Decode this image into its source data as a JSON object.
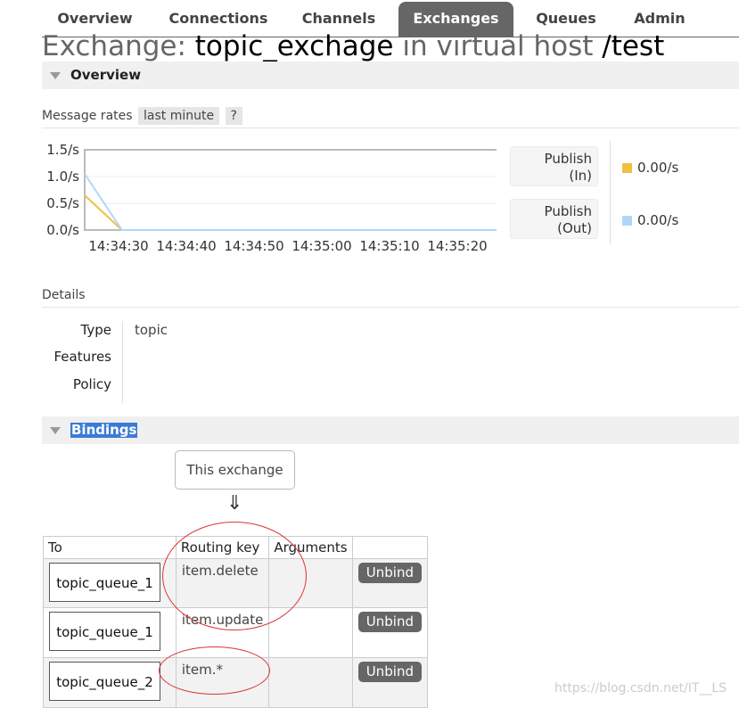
{
  "nav": {
    "tabs": [
      {
        "label": "Overview"
      },
      {
        "label": "Connections"
      },
      {
        "label": "Channels"
      },
      {
        "label": "Exchanges",
        "active": true
      },
      {
        "label": "Queues"
      },
      {
        "label": "Admin"
      }
    ]
  },
  "page": {
    "title_prefix": "Exchange:",
    "exchange_name": "topic_exchage",
    "title_mid": "in virtual host",
    "vhost": "/test"
  },
  "overview": {
    "header": "Overview",
    "rates_label": "Message rates",
    "range_pill": "last minute",
    "help_pill": "?"
  },
  "chart_data": {
    "type": "line",
    "x": [
      "14:34:30",
      "14:34:40",
      "14:34:50",
      "14:35:00",
      "14:35:10",
      "14:35:20"
    ],
    "y_ticks": [
      "1.5/s",
      "1.0/s",
      "0.5/s",
      "0.0/s"
    ],
    "ylim": [
      0,
      1.5
    ],
    "series": [
      {
        "name": "Publish (In)",
        "color": "#edc240",
        "points": [
          [
            0,
            0.65
          ],
          [
            0.09,
            0
          ],
          [
            1,
            0
          ]
        ]
      },
      {
        "name": "Publish (Out)",
        "color": "#afd8f8",
        "points": [
          [
            0,
            1.05
          ],
          [
            0.09,
            0
          ],
          [
            1,
            0
          ]
        ]
      }
    ]
  },
  "legend": [
    {
      "label_l1": "Publish",
      "label_l2": "(In)",
      "value": "0.00/s",
      "color": "#edc240"
    },
    {
      "label_l1": "Publish",
      "label_l2": "(Out)",
      "value": "0.00/s",
      "color": "#afd8f8"
    }
  ],
  "details": {
    "header": "Details",
    "type_label": "Type",
    "type_value": "topic",
    "features_label": "Features",
    "policy_label": "Policy"
  },
  "bindings": {
    "header": "Bindings",
    "this_exchange": "This exchange",
    "arrow": "⇓",
    "columns": [
      "To",
      "Routing key",
      "Arguments",
      ""
    ],
    "rows": [
      {
        "queue": "topic_queue_1",
        "routing_key": "item.delete",
        "action": "Unbind"
      },
      {
        "queue": "topic_queue_1",
        "routing_key": "item.update",
        "action": "Unbind"
      },
      {
        "queue": "topic_queue_2",
        "routing_key": "item.*",
        "action": "Unbind"
      }
    ]
  },
  "watermark": "https://blog.csdn.net/IT__LS"
}
